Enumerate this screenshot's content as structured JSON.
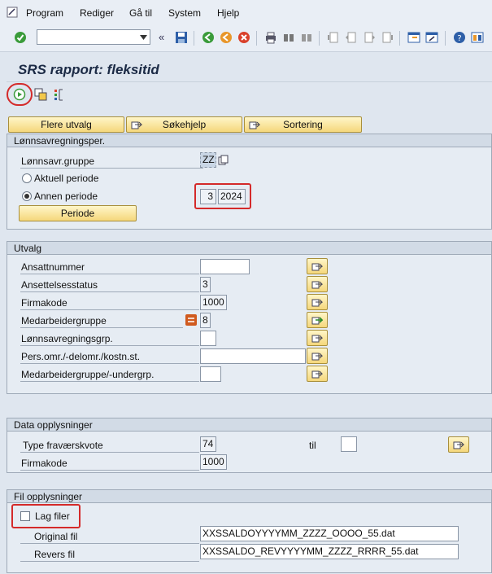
{
  "menu": {
    "items": [
      {
        "label": "Program"
      },
      {
        "label": "Rediger"
      },
      {
        "label": "Gå til"
      },
      {
        "label": "System"
      },
      {
        "label": "Hjelp"
      }
    ]
  },
  "toolbar": {
    "command_value": "",
    "icons": [
      "enter-icon",
      "back-double-icon",
      "save-icon",
      "back-icon",
      "exit-icon",
      "cancel-icon",
      "print-icon",
      "find-icon",
      "find-next-icon",
      "first-page-icon",
      "prev-page-icon",
      "next-page-icon",
      "last-page-icon",
      "new-session-icon",
      "shortcut-icon",
      "help-icon",
      "layout-icon"
    ]
  },
  "page": {
    "title": "SRS rapport: fleksitid"
  },
  "buttons": {
    "flere_utvalg": "Flere utvalg",
    "sokehjelp": "Søkehjelp",
    "sortering": "Sortering",
    "periode": "Periode"
  },
  "lonnsavregning": {
    "title": "Lønnsavregningsper.",
    "gruppe_label": "Lønnsavr.gruppe",
    "gruppe_value": "ZZ",
    "aktuell_label": "Aktuell periode",
    "annen_label": "Annen periode",
    "selected": "annen",
    "period": "3",
    "year": "2024"
  },
  "utvalg": {
    "title": "Utvalg",
    "rows": [
      {
        "label": "Ansattnummer",
        "value": ""
      },
      {
        "label": "Ansettelsesstatus",
        "value": "3"
      },
      {
        "label": "Firmakode",
        "value": "1000"
      },
      {
        "label": "Medarbeidergruppe",
        "value": "8"
      },
      {
        "label": "Lønnsavregningsgrp.",
        "value": ""
      },
      {
        "label": "Pers.omr./-delomr./kostn.st.",
        "value": ""
      },
      {
        "label": "Medarbeidergruppe/-undergrp.",
        "value": ""
      }
    ]
  },
  "data_opplysninger": {
    "title": "Data opplysninger",
    "type_label": "Type fraværskvote",
    "type_value": "74",
    "til_label": "til",
    "til_value": "",
    "firmakode_label": "Firmakode",
    "firmakode_value": "1000"
  },
  "fil_opplysninger": {
    "title": "Fil opplysninger",
    "lag_filer_label": "Lag filer",
    "lag_filer_checked": false,
    "original_label": "Original fil",
    "original_value": "XXSSALDOYYYYMM_ZZZZ_OOOO_55.dat",
    "revers_label": "Revers fil",
    "revers_value": "XXSSALDO_REVYYYYMM_ZZZZ_RRRR_55.dat"
  },
  "colors": {
    "accent_red": "#d42a2a",
    "button_yellow": "#f5d77b",
    "background": "#dfe6ef"
  }
}
